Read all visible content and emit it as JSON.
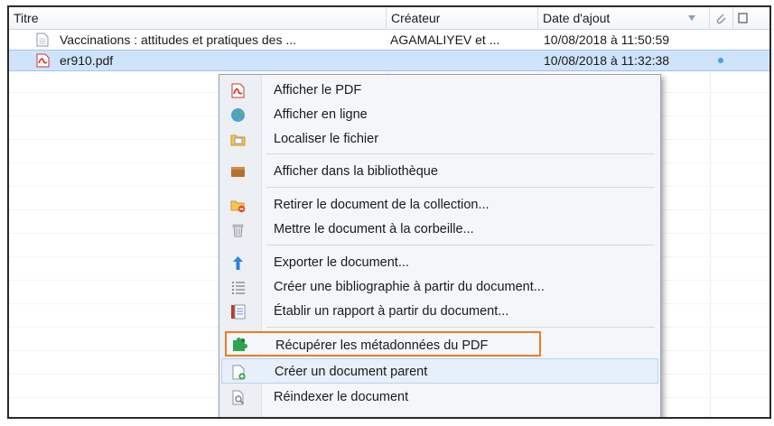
{
  "table": {
    "columns": {
      "title": "Titre",
      "creator": "Créateur",
      "date_added": "Date d'ajout"
    },
    "rows": [
      {
        "title": "Vaccinations : attitudes et pratiques des ...",
        "creator": "AGAMALIYEV et ...",
        "date_added": "10/08/2018 à 11:50:59",
        "icon": "document-icon"
      },
      {
        "title": "er910.pdf",
        "creator": "",
        "date_added": "10/08/2018 à 11:32:38",
        "icon": "pdf-icon"
      }
    ]
  },
  "context_menu": {
    "items": [
      {
        "label": "Afficher le PDF",
        "icon": "pdf-icon"
      },
      {
        "label": "Afficher en ligne",
        "icon": "globe-icon"
      },
      {
        "label": "Localiser le fichier",
        "icon": "folder-icon"
      },
      {
        "label": "Afficher dans la bibliothèque",
        "icon": "library-icon"
      },
      {
        "label": "Retirer le document de la collection...",
        "icon": "folder-remove-icon"
      },
      {
        "label": "Mettre le document à la corbeille...",
        "icon": "trash-icon"
      },
      {
        "label": "Exporter le document...",
        "icon": "export-icon"
      },
      {
        "label": "Créer une bibliographie à partir du document...",
        "icon": "bibliography-icon"
      },
      {
        "label": "Établir un rapport à partir du document...",
        "icon": "report-icon"
      },
      {
        "label": "Récupérer les métadonnées du PDF",
        "icon": "puzzle-icon"
      },
      {
        "label": "Créer un document parent",
        "icon": "new-parent-icon"
      },
      {
        "label": "Réindexer le document",
        "icon": "reindex-icon"
      }
    ]
  },
  "colors": {
    "selection": "#cfe3fb",
    "highlight_border": "#f07a22"
  }
}
